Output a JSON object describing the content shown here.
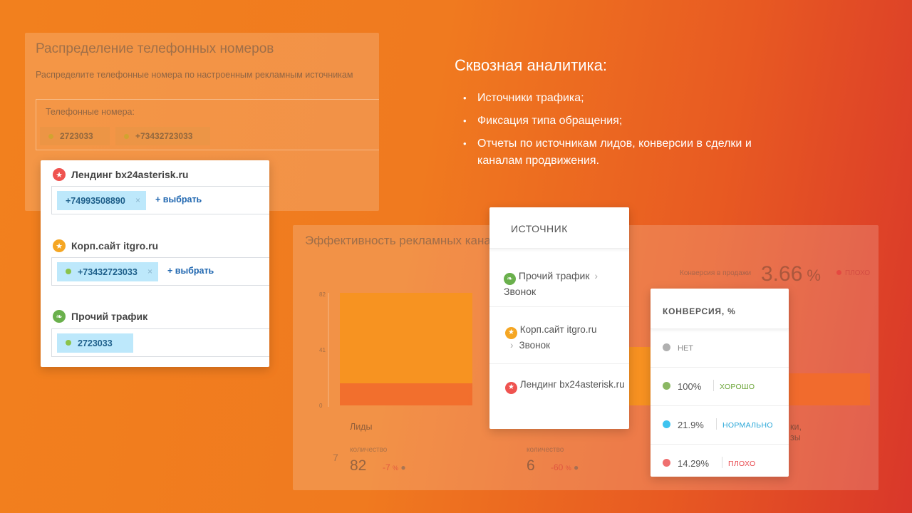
{
  "phones_panel": {
    "title": "Распределение телефонных номеров",
    "subtitle": "Распределите телефонные номера по настроенным рекламным источникам",
    "box_label": "Телефонные номера:",
    "chips": [
      "2723033",
      "+73432723033"
    ]
  },
  "sources_card": {
    "items": [
      {
        "title": "Лендинг bx24asterisk.ru",
        "icon": "star-icon",
        "phone": "+74993508890",
        "pick": "+ выбрать"
      },
      {
        "title": "Корп.сайт itgro.ru",
        "icon": "star-icon",
        "phone": "+73432723033",
        "pick": "+ выбрать"
      },
      {
        "title": "Прочий трафик",
        "icon": "leaf-icon",
        "phone": "2723033"
      }
    ]
  },
  "hero": {
    "title": "Сквозная аналитика:",
    "bullets": [
      "Источники трафика;",
      "Фиксация типа обращения;",
      "Отчеты по источникам лидов, конверсии в сделки и каналам продвижения."
    ]
  },
  "eff_panel": {
    "title": "Эффективность рекламных канал",
    "conv_label": "Конверсия в продажи",
    "conv_value": "3.66",
    "conv_unit": "%",
    "conv_status": "ПЛОХО",
    "y_ticks": [
      "82",
      "41",
      "0"
    ],
    "col1_label": "Лиды",
    "col1_sub": "количество",
    "col1_value": "82",
    "col1_delta": "-7",
    "col1_delta_unit": "%",
    "col2_sub": "количество",
    "col2_value": "6",
    "col2_delta": "-60",
    "col2_delta_unit": "%",
    "left_stub": "7",
    "col3_partial": [
      "ки,",
      "зы"
    ]
  },
  "filter_card": {
    "header": "ИСТОЧНИК",
    "items": [
      {
        "name": "Прочий трафик",
        "type": "Звонок",
        "icon": "leaf-icon"
      },
      {
        "name": "Корп.сайт itgro.ru",
        "type": "Звонок",
        "icon": "star-icon"
      },
      {
        "name": "Лендинг bx24asterisk.ru",
        "type": "Звонок",
        "icon": "star-icon"
      }
    ]
  },
  "conv_card": {
    "header": "КОНВЕРСИЯ, %",
    "rows": [
      {
        "pct": "НЕТ",
        "label": "",
        "color": "#b0b0b0"
      },
      {
        "pct": "100%",
        "label": "ХОРОШО",
        "color": "#8bb863",
        "label_color": "#6aa436"
      },
      {
        "pct": "21.9%",
        "label": "НОРМАЛЬНО",
        "color": "#3ec3ef",
        "label_color": "#2aa7d8"
      },
      {
        "pct": "14.29%",
        "label": "ПЛОХО",
        "color": "#ef6f6f",
        "label_color": "#e8474c"
      }
    ]
  },
  "colors": {
    "bar_orange": "#f7941d",
    "bar_red": "#f26b2a",
    "chip_blue": "#bde8fb",
    "link_blue": "#2067b0"
  }
}
